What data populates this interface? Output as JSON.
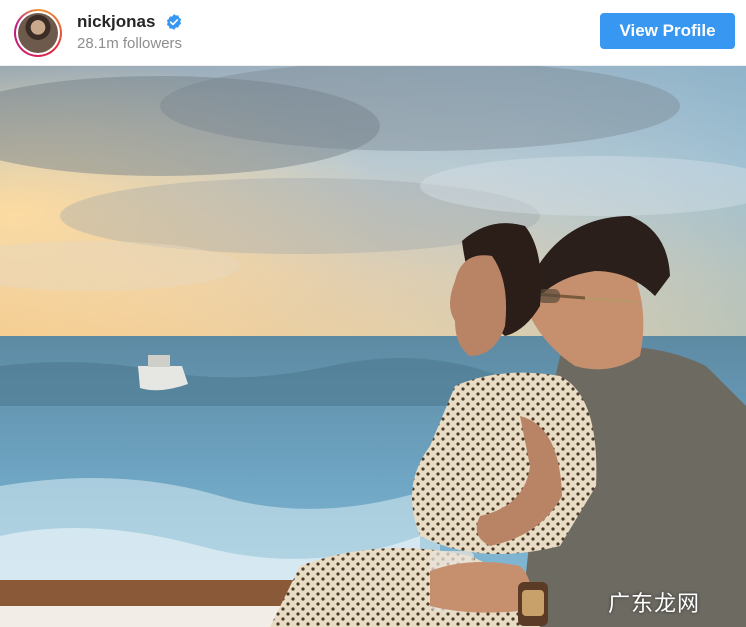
{
  "profile": {
    "username": "nickjonas",
    "followers": "28.1m followers",
    "verified_icon": "verified-badge-icon",
    "view_profile_label": "View Profile"
  },
  "colors": {
    "button": "#3897f0",
    "verified": "#3897f0",
    "muted_text": "#8e8e8e"
  },
  "watermark": "广东龙网"
}
